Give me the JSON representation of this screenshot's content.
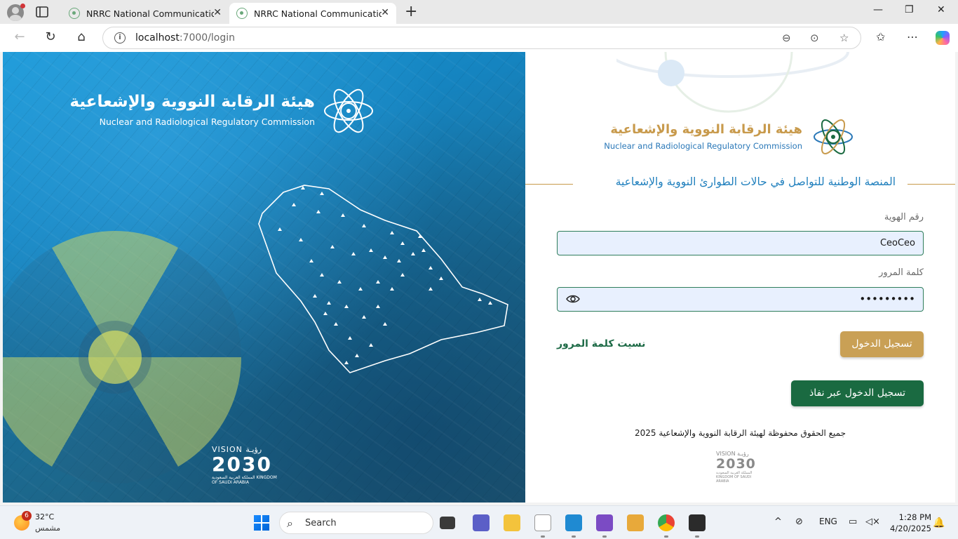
{
  "browser": {
    "tabs": [
      {
        "title": "NRRC National Communication P",
        "active": false
      },
      {
        "title": "NRRC National Communication P",
        "active": true
      }
    ],
    "url_host": "localhost",
    "url_path": ":7000/login"
  },
  "hero": {
    "org_name_ar": "هيئة الرقابة النووية والإشعاعية",
    "org_name_en": "Nuclear and Radiological Regulatory Commission",
    "vision": {
      "line1": "VISION رؤيـة",
      "year": "2030",
      "country": "المملكة العربية السعودية KINGDOM OF SAUDI ARABIA"
    }
  },
  "panel": {
    "org_name_ar": "هيئة الرقابة النووية والإشعاعية",
    "org_name_en": "Nuclear and Radiological Regulatory Commission",
    "platform_title": "المنصة الوطنية للتواصل في حالات الطوارئ النووية والإشعاعية",
    "id_label": "رقم الهوية",
    "id_value": "CeoCeo",
    "password_label": "كلمة المرور",
    "password_value": "•••••••••",
    "login_button": "تسجيل الدخول",
    "forgot_password": "نسيت كلمة المرور",
    "nafath_button": "تسجيل الدخول عبر نفاذ",
    "copyright": "جميع الحقوق محفوظة لهيئة الرقابة النووية والإشعاعية 2025",
    "vision": {
      "line1": "VISION رؤيـة",
      "year": "2030",
      "country": "المملكة العربية السعودية KINGDOM OF SAUDI ARABIA"
    }
  },
  "taskbar": {
    "weather_temp": "32°C",
    "weather_desc": "مشمس",
    "weather_badge": "6",
    "search_placeholder": "Search",
    "language": "ENG",
    "time": "1:28 PM",
    "date": "4/20/2025"
  },
  "colors": {
    "gold": "#c9a055",
    "green": "#1a6a41",
    "blue_text": "#1f7fbd"
  }
}
